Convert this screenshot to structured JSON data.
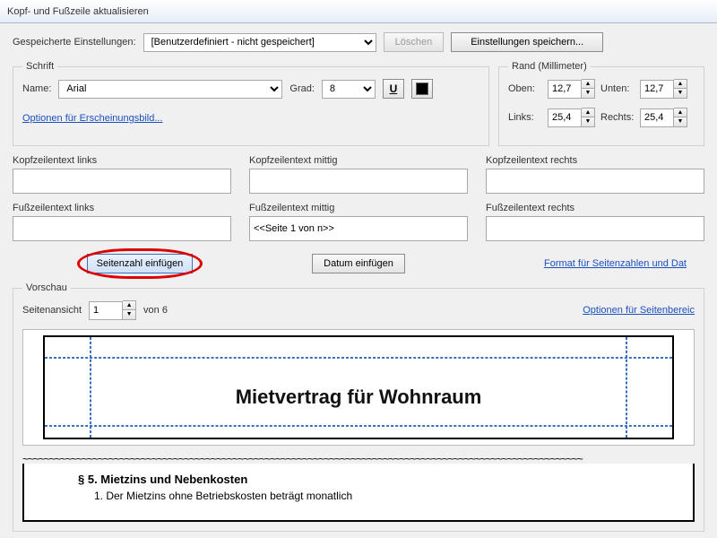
{
  "window_title": "Kopf- und Fußzeile aktualisieren",
  "saved_settings": {
    "label": "Gespeicherte Einstellungen:",
    "value": "[Benutzerdefiniert - nicht gespeichert]",
    "delete_btn": "Löschen",
    "save_btn": "Einstellungen speichern..."
  },
  "font_group": {
    "legend": "Schrift",
    "name_label": "Name:",
    "name_value": "Arial",
    "size_label": "Grad:",
    "size_value": "8",
    "appearance_link": "Optionen für Erscheinungsbild..."
  },
  "margin_group": {
    "legend": "Rand (Millimeter)",
    "top_label": "Oben:",
    "top_value": "12,7",
    "bottom_label": "Unten:",
    "bottom_value": "12,7",
    "left_label": "Links:",
    "left_value": "25,4",
    "right_label": "Rechts:",
    "right_value": "25,4"
  },
  "hf": {
    "header_left_label": "Kopfzeilentext links",
    "header_left": "",
    "header_center_label": "Kopfzeilentext mittig",
    "header_center": "",
    "header_right_label": "Kopfzeilentext rechts",
    "header_right": "",
    "footer_left_label": "Fußzeilentext links",
    "footer_left": "",
    "footer_center_label": "Fußzeilentext mittig",
    "footer_center": "<<Seite 1 von n>>",
    "footer_right_label": "Fußzeilentext rechts",
    "footer_right": ""
  },
  "buttons": {
    "insert_page": "Seitenzahl einfügen",
    "insert_date": "Datum einfügen",
    "page_format_link": "Format für Seitenzahlen und Dat"
  },
  "preview": {
    "legend": "Vorschau",
    "page_view_label": "Seitenansicht",
    "page_value": "1",
    "page_total_label": "von 6",
    "page_range_link": "Optionen für Seitenbereic",
    "doc_title": "Mietvertrag für Wohnraum",
    "section_heading": "§ 5.   Mietzins und Nebenkosten",
    "section_item": "1.   Der Mietzins ohne Betriebskosten beträgt monatlich"
  }
}
